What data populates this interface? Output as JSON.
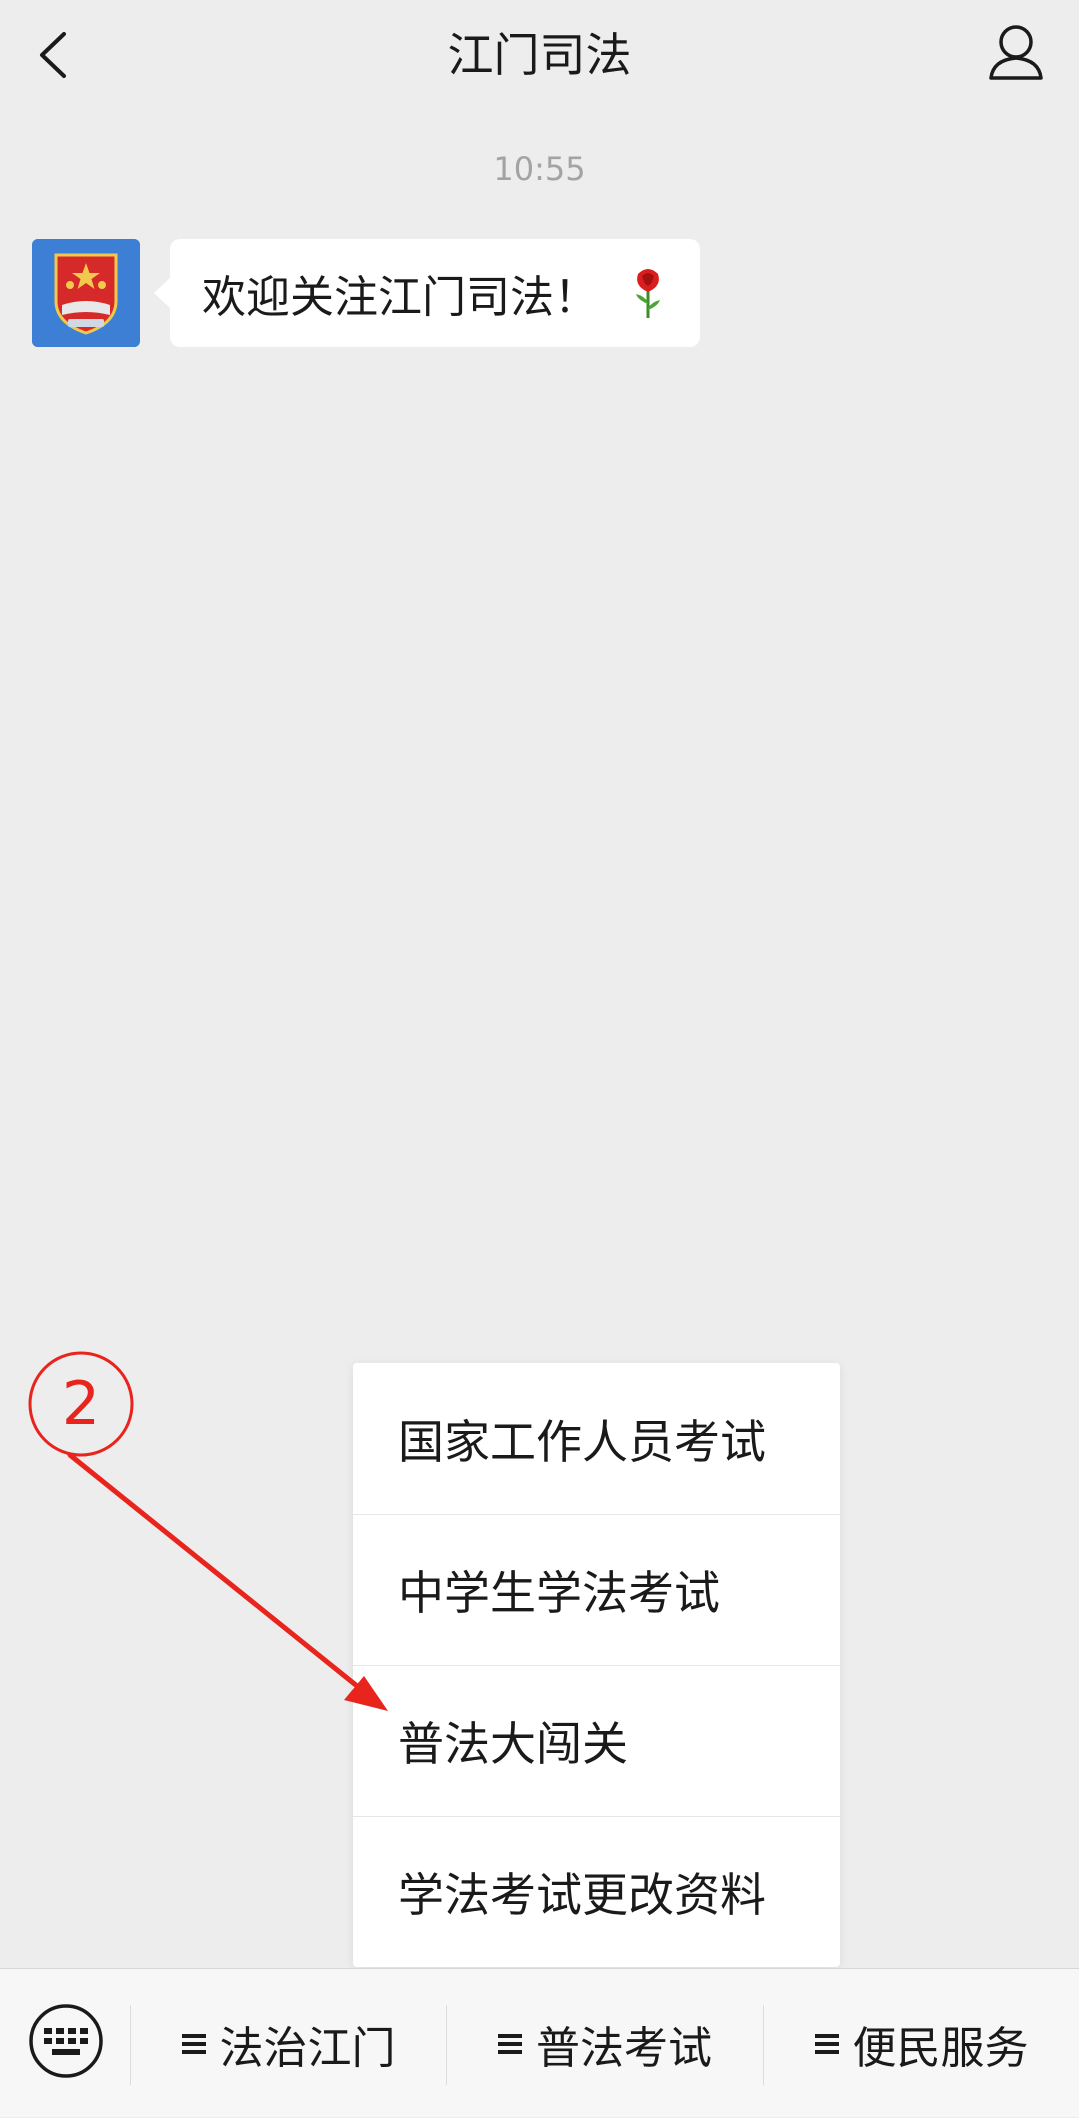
{
  "header": {
    "title": "江门司法",
    "back_icon": "chevron-left-icon",
    "profile_icon": "person-icon"
  },
  "chat": {
    "timestamp": "10:55",
    "message": "欢迎关注江门司法！",
    "emoji": "rose-icon",
    "avatar_icon": "justice-emblem-icon"
  },
  "annotation": {
    "step_label": "2",
    "color": "#e8241d"
  },
  "submenu": {
    "items": [
      "国家工作人员考试",
      "中学生学法考试",
      "普法大闯关",
      "学法考试更改资料"
    ]
  },
  "bottom_menu": {
    "keyboard_icon": "keyboard-icon",
    "items": [
      "法治江门",
      "普法考试",
      "便民服务"
    ]
  },
  "colors": {
    "background": "#ededed",
    "bubble": "#ffffff",
    "avatar_bg": "#3e7fd6",
    "emblem_red": "#d62a2a"
  }
}
